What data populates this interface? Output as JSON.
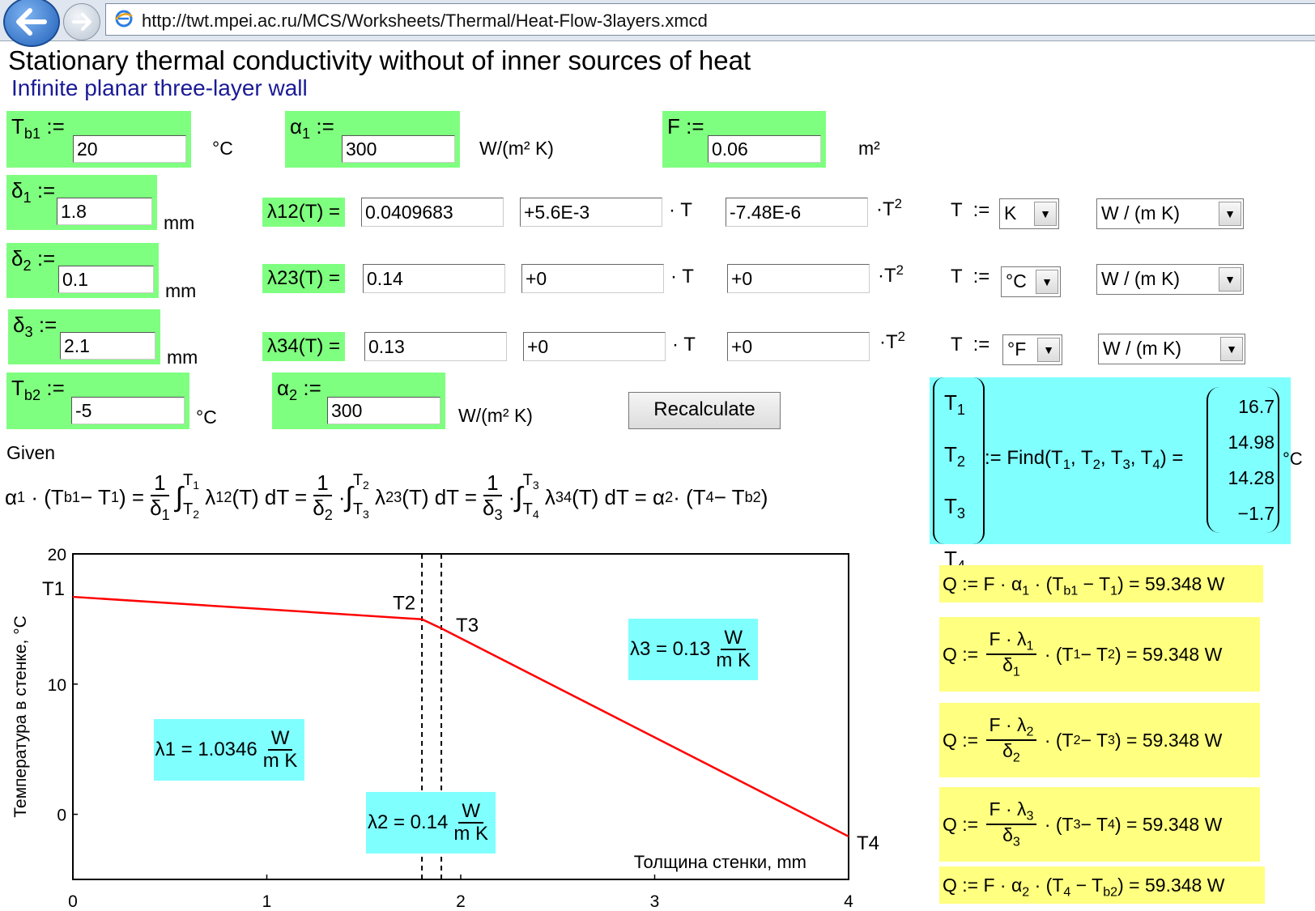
{
  "browser": {
    "url": "http://twt.mpei.ac.ru/MCS/Worksheets/Thermal/Heat-Flow-3layers.xmcd"
  },
  "page": {
    "title": "Stationary thermal conductivity without of inner sources of heat",
    "subtitle": "Infinite planar three-layer wall"
  },
  "inputs": {
    "Tb1": {
      "value": "20",
      "unit": "°C"
    },
    "alpha1": {
      "value": "300",
      "unit": "W/(m² K)"
    },
    "F": {
      "value": "0.06",
      "unit": "m²"
    },
    "delta1": {
      "value": "1.8",
      "unit": "mm"
    },
    "delta2": {
      "value": "0.1",
      "unit": "mm"
    },
    "delta3": {
      "value": "2.1",
      "unit": "mm"
    },
    "Tb2": {
      "value": "-5",
      "unit": "°C"
    },
    "alpha2": {
      "value": "300",
      "unit": "W/(m² K)"
    }
  },
  "lambdas": [
    {
      "label": "λ12(T) =",
      "a": "0.0409683",
      "b": "+5.6E-3",
      "c": "-7.48E-6",
      "tunit": "K",
      "unit": "W / (m  K)"
    },
    {
      "label": "λ23(T) =",
      "a": "0.14",
      "b": "+0",
      "c": "+0",
      "tunit": "°C",
      "unit": "W / (m  K)"
    },
    {
      "label": "λ34(T) =",
      "a": "0.13",
      "b": "+0",
      "c": "+0",
      "tunit": "°F",
      "unit": "W / (m  K)"
    }
  ],
  "recalc_label": "Recalculate",
  "given_label": "Given",
  "solution": {
    "values": [
      "16.7",
      "14.98",
      "14.28",
      "−1.7"
    ],
    "unit": "°C"
  },
  "heat_flow": {
    "value": "59.348",
    "unit": "W"
  },
  "chart_data": {
    "type": "line",
    "xlabel": "Толщина стенки, mm",
    "ylabel": "Температура в стенке, °C",
    "xlim": [
      0,
      4
    ],
    "ylim": [
      -5,
      20
    ],
    "xticks": [
      "0",
      "1",
      "2",
      "3",
      "4"
    ],
    "yticks": [
      "0",
      "10",
      "20"
    ],
    "series": [
      {
        "x": [
          0,
          1.8,
          1.9,
          4.0
        ],
        "y": [
          16.7,
          14.98,
          14.28,
          -1.7
        ],
        "color": "#ff0000"
      }
    ],
    "vlines": [
      1.8,
      1.9
    ],
    "point_labels": [
      "T1",
      "T2",
      "T3",
      "T4"
    ],
    "annotations": [
      {
        "name": "λ1",
        "value": "1.0346"
      },
      {
        "name": "λ2",
        "value": "0.14"
      },
      {
        "name": "λ3",
        "value": "0.13"
      }
    ],
    "annotation_unit": {
      "num": "W",
      "den": "m K"
    }
  }
}
